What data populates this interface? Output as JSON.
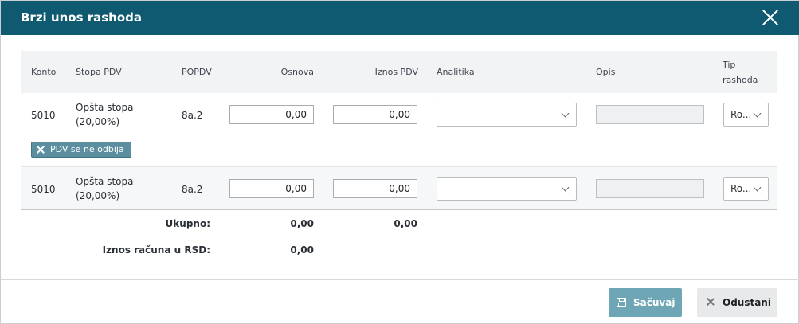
{
  "dialog": {
    "title": "Brzi unos rashoda",
    "close_icon": "close-icon"
  },
  "table": {
    "headers": {
      "konto": "Konto",
      "stopa_pdv": "Stopa PDV",
      "popdv": "POPDV",
      "osnova": "Osnova",
      "iznos_pdv": "Iznos PDV",
      "analitika": "Analitika",
      "opis": "Opis",
      "tip_rashoda_line1": "Tip",
      "tip_rashoda_line2": "rashoda"
    },
    "rows": [
      {
        "konto": "5010",
        "stopa_line1": "Opšta stopa",
        "stopa_line2": "(20,00%)",
        "popdv": "8a.2",
        "osnova": "0,00",
        "iznos_pdv": "0,00",
        "analitika": "",
        "opis": "",
        "tip": "Ro...",
        "badge": "PDV se ne odbija"
      },
      {
        "konto": "5010",
        "stopa_line1": "Opšta stopa",
        "stopa_line2": "(20,00%)",
        "popdv": "8a.2",
        "osnova": "0,00",
        "iznos_pdv": "0,00",
        "analitika": "",
        "opis": "",
        "tip": "Ro..."
      }
    ]
  },
  "totals": {
    "ukupno_label": "Ukupno:",
    "ukupno_osnova": "0,00",
    "ukupno_pdv": "0,00",
    "iznos_label": "Iznos računa u RSD:",
    "iznos_value": "0,00"
  },
  "footer": {
    "save_label": "Sačuvaj",
    "cancel_label": "Odustani"
  },
  "colors": {
    "header": "#0f5a70",
    "save_button": "#6fa6b5",
    "badge": "#5b8fa0"
  }
}
